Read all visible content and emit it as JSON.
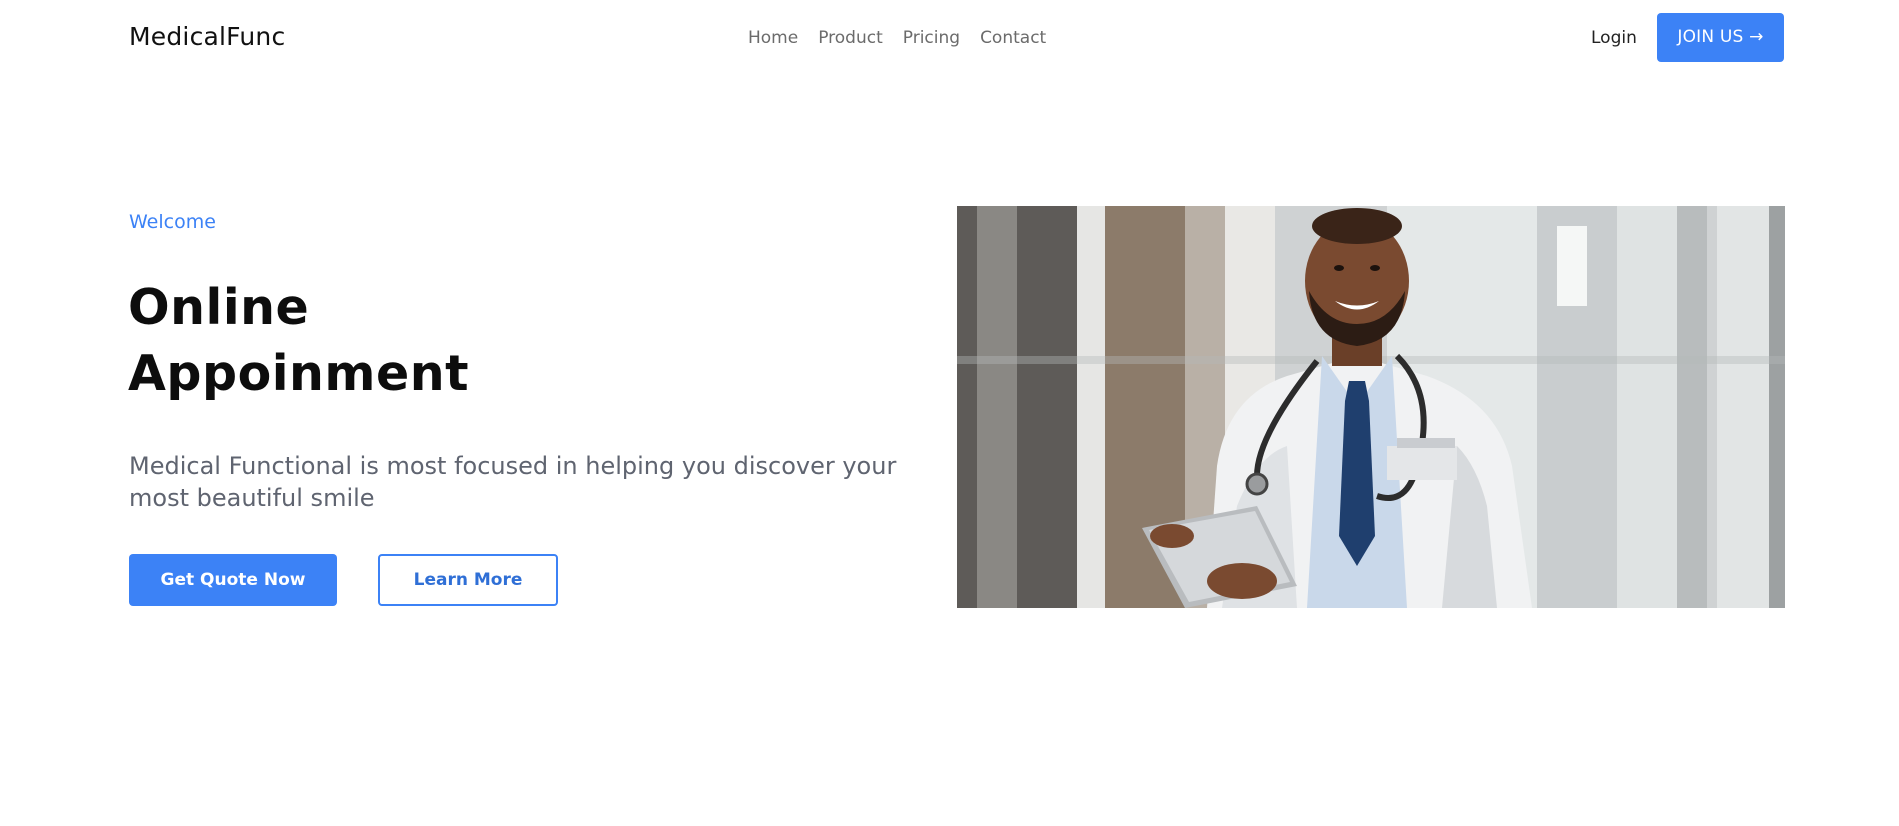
{
  "brand": {
    "name": "MedicalFunc"
  },
  "nav": {
    "items": [
      "Home",
      "Product",
      "Pricing",
      "Contact"
    ]
  },
  "header_actions": {
    "login_label": "Login",
    "join_label": "JOIN US →"
  },
  "hero": {
    "eyebrow": "Welcome",
    "title_line1": "Online",
    "title_line2": "Appoinment",
    "subtitle": "Medical Functional is most focused in helping you discover your most beautiful smile",
    "primary_button": "Get Quote Now",
    "secondary_button": "Learn More"
  },
  "colors": {
    "accent": "#3c82f6",
    "text_dark": "#0d0d0d",
    "text_muted": "#5f6470",
    "nav_text": "#6b6b6b",
    "background": "#ffffff"
  }
}
